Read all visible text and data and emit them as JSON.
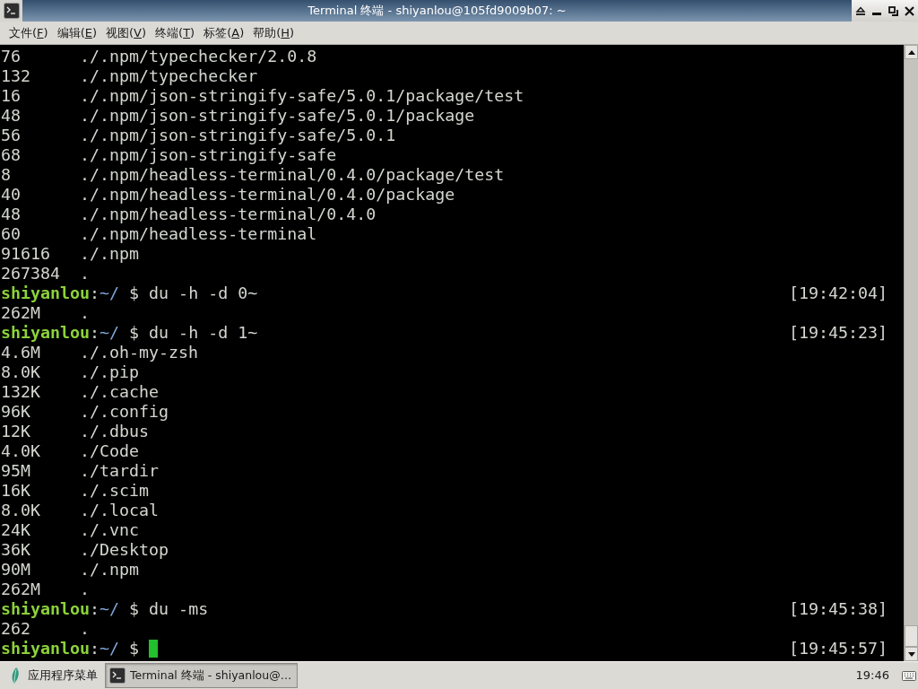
{
  "window": {
    "title": "Terminal 终端 - shiyanlou@105fd9009b07: ~"
  },
  "menu": [
    {
      "before": "文件(",
      "accel": "F",
      "after": ")"
    },
    {
      "before": "编辑(",
      "accel": "E",
      "after": ")"
    },
    {
      "before": "视图(",
      "accel": "V",
      "after": ")"
    },
    {
      "before": "终端(",
      "accel": "T",
      "after": ")"
    },
    {
      "before": "标签(",
      "accel": "A",
      "after": ")"
    },
    {
      "before": "帮助(",
      "accel": "H",
      "after": ")"
    }
  ],
  "terminal": {
    "lines": [
      {
        "kind": "output",
        "size": "76",
        "path": "./.npm/typechecker/2.0.8"
      },
      {
        "kind": "output",
        "size": "132",
        "path": "./.npm/typechecker"
      },
      {
        "kind": "output",
        "size": "16",
        "path": "./.npm/json-stringify-safe/5.0.1/package/test"
      },
      {
        "kind": "output",
        "size": "48",
        "path": "./.npm/json-stringify-safe/5.0.1/package"
      },
      {
        "kind": "output",
        "size": "56",
        "path": "./.npm/json-stringify-safe/5.0.1"
      },
      {
        "kind": "output",
        "size": "68",
        "path": "./.npm/json-stringify-safe"
      },
      {
        "kind": "output",
        "size": "8",
        "path": "./.npm/headless-terminal/0.4.0/package/test"
      },
      {
        "kind": "output",
        "size": "40",
        "path": "./.npm/headless-terminal/0.4.0/package"
      },
      {
        "kind": "output",
        "size": "48",
        "path": "./.npm/headless-terminal/0.4.0"
      },
      {
        "kind": "output",
        "size": "60",
        "path": "./.npm/headless-terminal"
      },
      {
        "kind": "output",
        "size": "91616",
        "path": "./.npm"
      },
      {
        "kind": "output",
        "size": "267384",
        "path": "."
      },
      {
        "kind": "prompt",
        "user": "shiyanlou",
        "separator": ":",
        "cwd": "~/",
        "command": "$ du -h -d 0~",
        "cursor": false,
        "time": "[19:42:04]"
      },
      {
        "kind": "output",
        "size": "262M",
        "path": "."
      },
      {
        "kind": "prompt",
        "user": "shiyanlou",
        "separator": ":",
        "cwd": "~/",
        "command": "$ du -h -d 1~",
        "cursor": false,
        "time": "[19:45:23]"
      },
      {
        "kind": "output",
        "size": "4.6M",
        "path": "./.oh-my-zsh"
      },
      {
        "kind": "output",
        "size": "8.0K",
        "path": "./.pip"
      },
      {
        "kind": "output",
        "size": "132K",
        "path": "./.cache"
      },
      {
        "kind": "output",
        "size": "96K",
        "path": "./.config"
      },
      {
        "kind": "output",
        "size": "12K",
        "path": "./.dbus"
      },
      {
        "kind": "output",
        "size": "4.0K",
        "path": "./Code"
      },
      {
        "kind": "output",
        "size": "95M",
        "path": "./tardir"
      },
      {
        "kind": "output",
        "size": "16K",
        "path": "./.scim"
      },
      {
        "kind": "output",
        "size": "8.0K",
        "path": "./.local"
      },
      {
        "kind": "output",
        "size": "24K",
        "path": "./.vnc"
      },
      {
        "kind": "output",
        "size": "36K",
        "path": "./Desktop"
      },
      {
        "kind": "output",
        "size": "90M",
        "path": "./.npm"
      },
      {
        "kind": "output",
        "size": "262M",
        "path": "."
      },
      {
        "kind": "prompt",
        "user": "shiyanlou",
        "separator": ":",
        "cwd": "~/",
        "command": "$ du -ms",
        "cursor": false,
        "time": "[19:45:38]"
      },
      {
        "kind": "output",
        "size": "262",
        "path": "."
      },
      {
        "kind": "prompt",
        "user": "shiyanlou",
        "separator": ":",
        "cwd": "~/",
        "command": "$",
        "cursor": true,
        "time": "[19:45:57]"
      }
    ]
  },
  "taskbar": {
    "start_menu": {
      "label": "应用程序菜单"
    },
    "tasks": [
      {
        "label": "Terminal 终端 - shiyanlou@…",
        "selected": true
      }
    ],
    "clock": "19:46"
  }
}
